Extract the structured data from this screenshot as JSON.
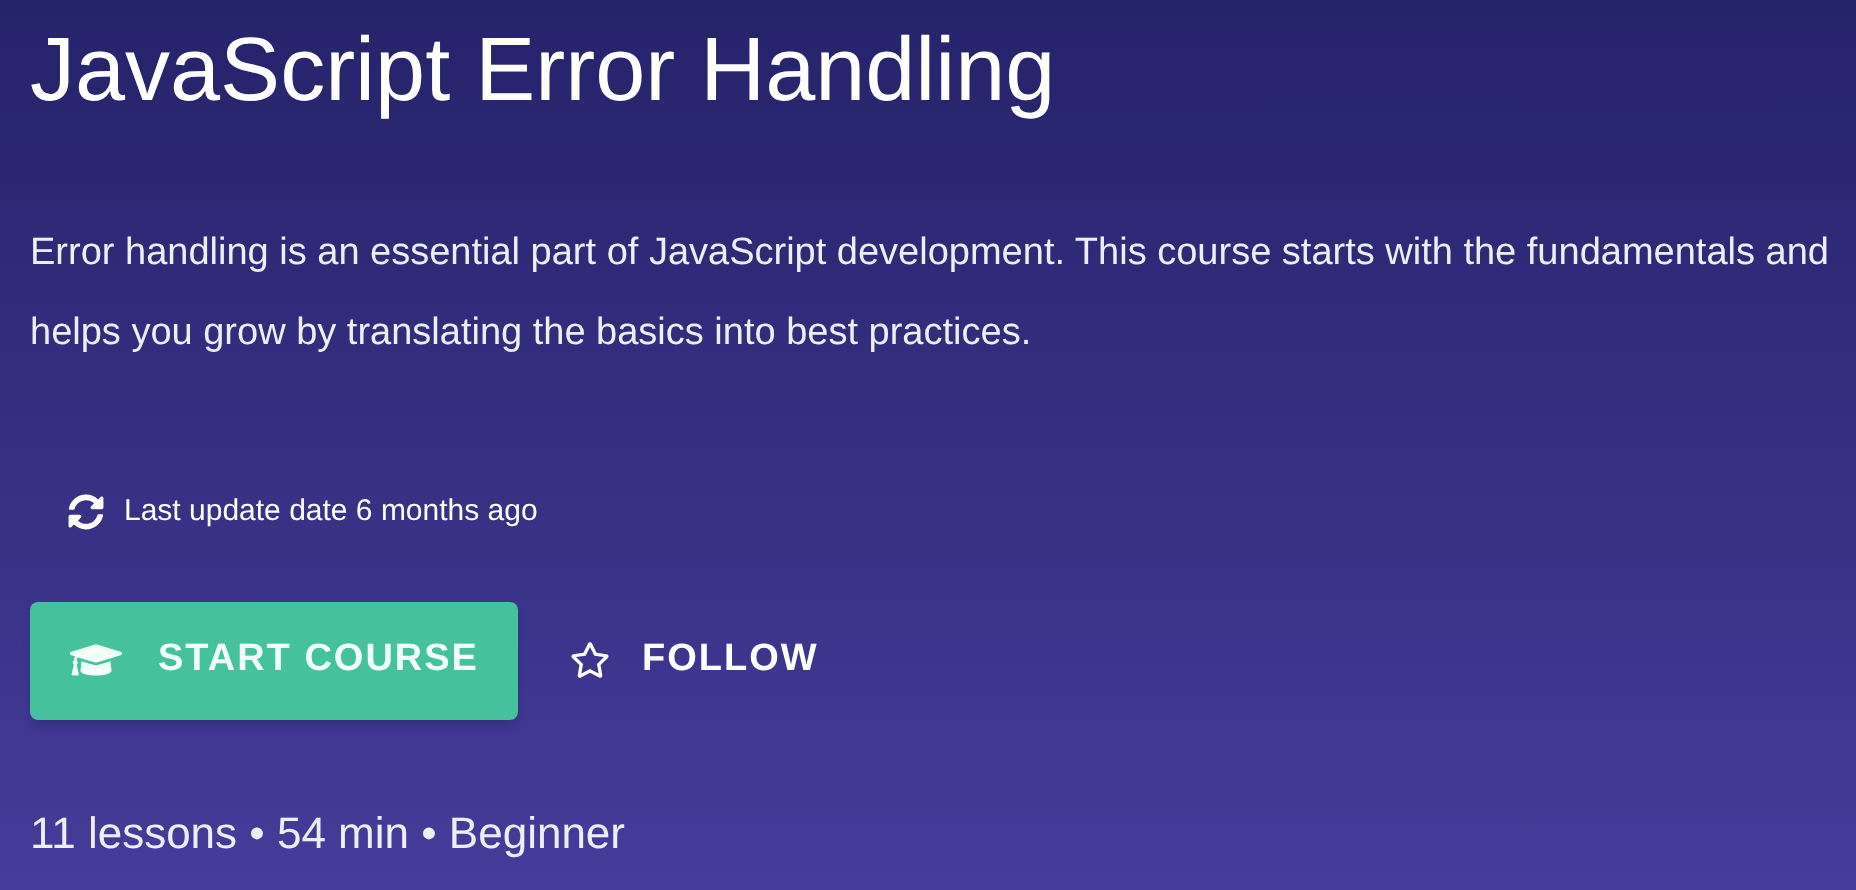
{
  "course": {
    "title": "JavaScript Error Handling",
    "description": "Error handling is an essential part of JavaScript development. This course starts with the fundamentals and helps you grow by translating the basics into best practices.",
    "last_update": "Last update date 6 months ago",
    "start_button": "START COURSE",
    "follow_button": {
      "label": "FOLLOW",
      "following": false
    },
    "meta": "11 lessons • 54 min • Beginner"
  }
}
